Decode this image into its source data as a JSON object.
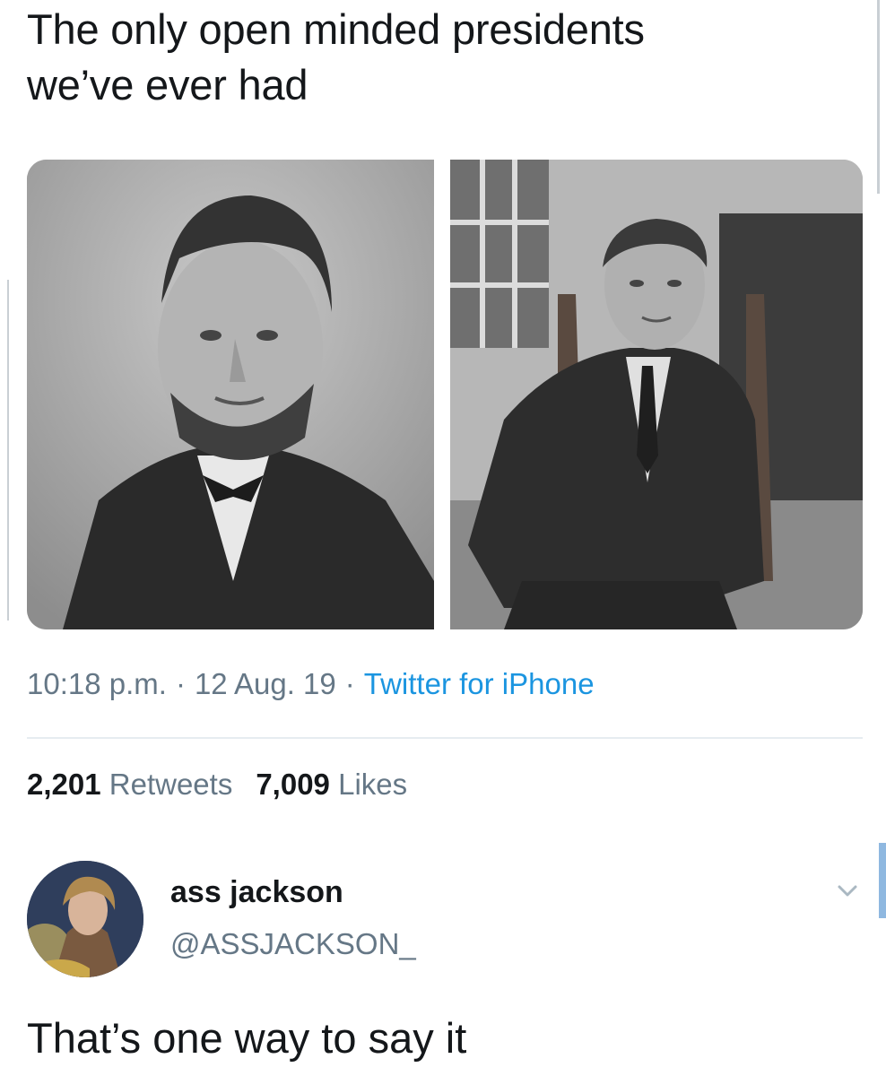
{
  "tweet": {
    "text_line1": "The only open minded presidents",
    "text_line2": "we’ve ever had",
    "time": "10:18 p.m.",
    "date": "12 Aug. 19",
    "source": "Twitter for iPhone",
    "separator": "·",
    "retweets_count": "2,201",
    "retweets_label": "Retweets",
    "likes_count": "7,009",
    "likes_label": "Likes"
  },
  "media": [
    {
      "name": "photo-left",
      "icon": "portrait-photo"
    },
    {
      "name": "photo-right",
      "icon": "portrait-photo"
    }
  ],
  "reply": {
    "display_name": "ass jackson",
    "handle": "@ASSJACKSON_",
    "text": "That’s one way to say it",
    "menu_icon": "chevron-down-icon"
  },
  "colors": {
    "text": "#14171a",
    "secondary": "#657786",
    "link": "#1b95e0",
    "divider": "#e6ecf0"
  }
}
